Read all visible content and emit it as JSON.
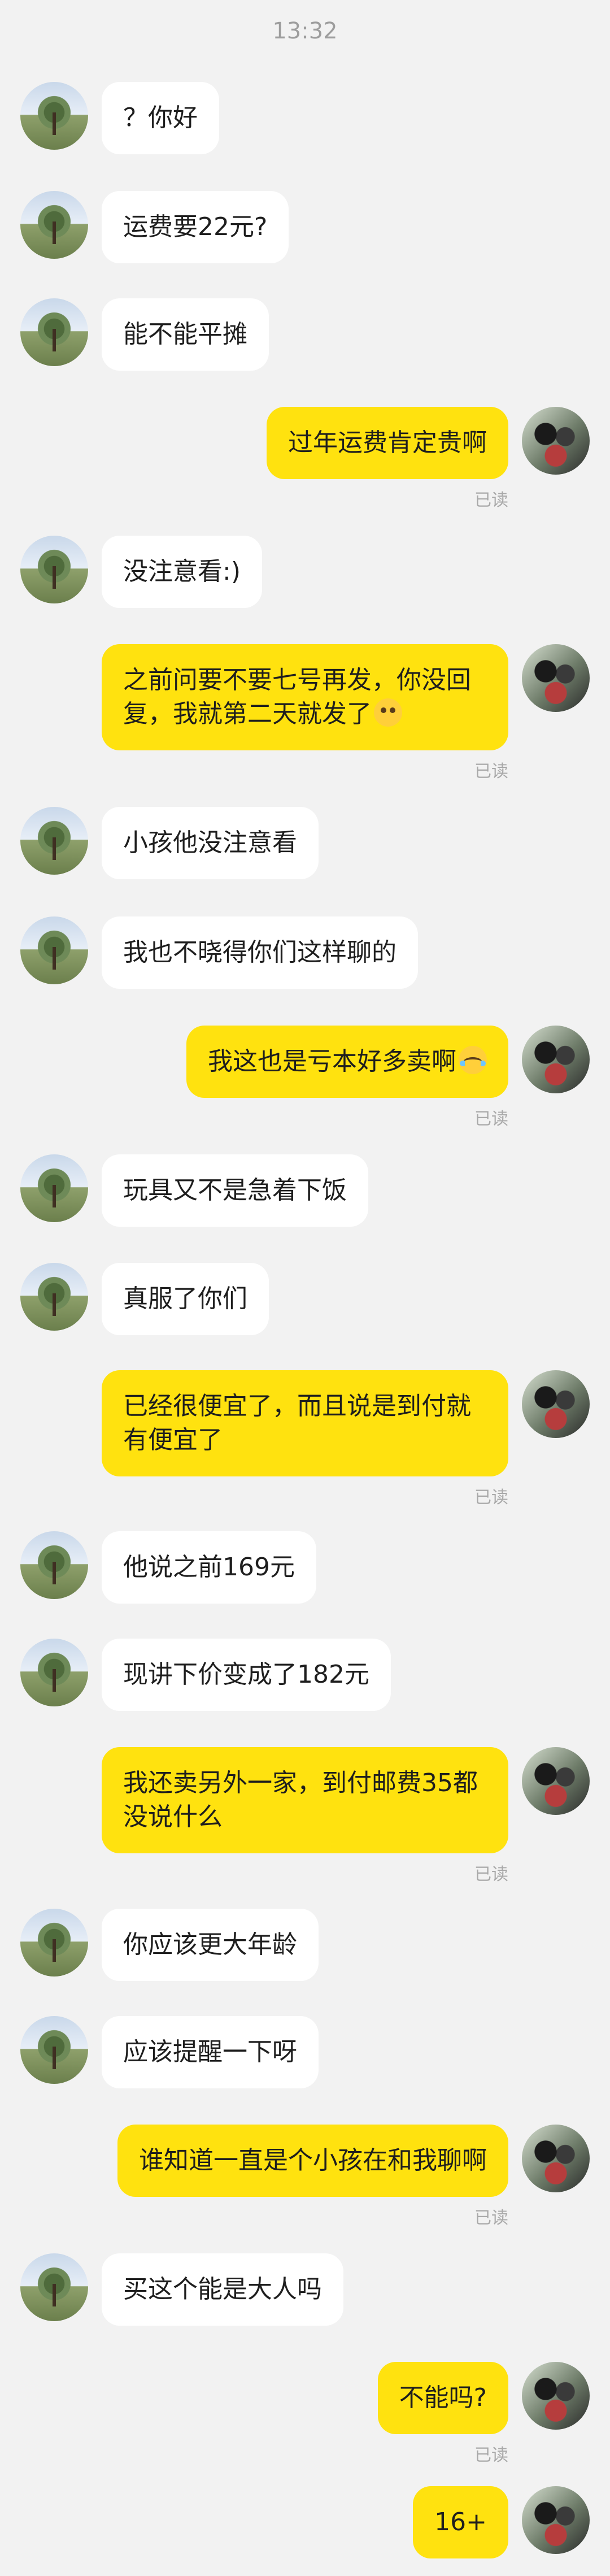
{
  "time": "13:32",
  "read_label": "已读",
  "messages": [
    {
      "side": "left",
      "text": "？你好"
    },
    {
      "side": "left",
      "text": "运费要22元?"
    },
    {
      "side": "left",
      "text": "能不能平摊"
    },
    {
      "side": "right",
      "text": "过年运费肯定贵啊"
    },
    {
      "side": "left",
      "text": "没注意看:)"
    },
    {
      "side": "right",
      "text": "之前问要不要七号再发，你没回复，我就第二天就发了",
      "emoji": "flushed-face-emoji"
    },
    {
      "side": "left",
      "text": "小孩他没注意看"
    },
    {
      "side": "left",
      "text": "我也不晓得你们这样聊的"
    },
    {
      "side": "right",
      "text": "我这也是亏本好多卖啊",
      "emoji": "crying-face-emoji"
    },
    {
      "side": "left",
      "text": "玩具又不是急着下饭"
    },
    {
      "side": "left",
      "text": "真服了你们"
    },
    {
      "side": "right",
      "text": "已经很便宜了，而且说是到付就有便宜了"
    },
    {
      "side": "left",
      "text": "他说之前169元"
    },
    {
      "side": "left",
      "text": "现讲下价变成了182元"
    },
    {
      "side": "right",
      "text": "我还卖另外一家，到付邮费35都没说什么"
    },
    {
      "side": "left",
      "text": "你应该更大年龄"
    },
    {
      "side": "left",
      "text": "应该提醒一下呀"
    },
    {
      "side": "right",
      "text": "谁知道一直是个小孩在和我聊啊"
    },
    {
      "side": "left",
      "text": "买这个能是大人吗"
    },
    {
      "side": "right",
      "text": "不能吗?"
    },
    {
      "side": "right",
      "text": "16+"
    }
  ]
}
